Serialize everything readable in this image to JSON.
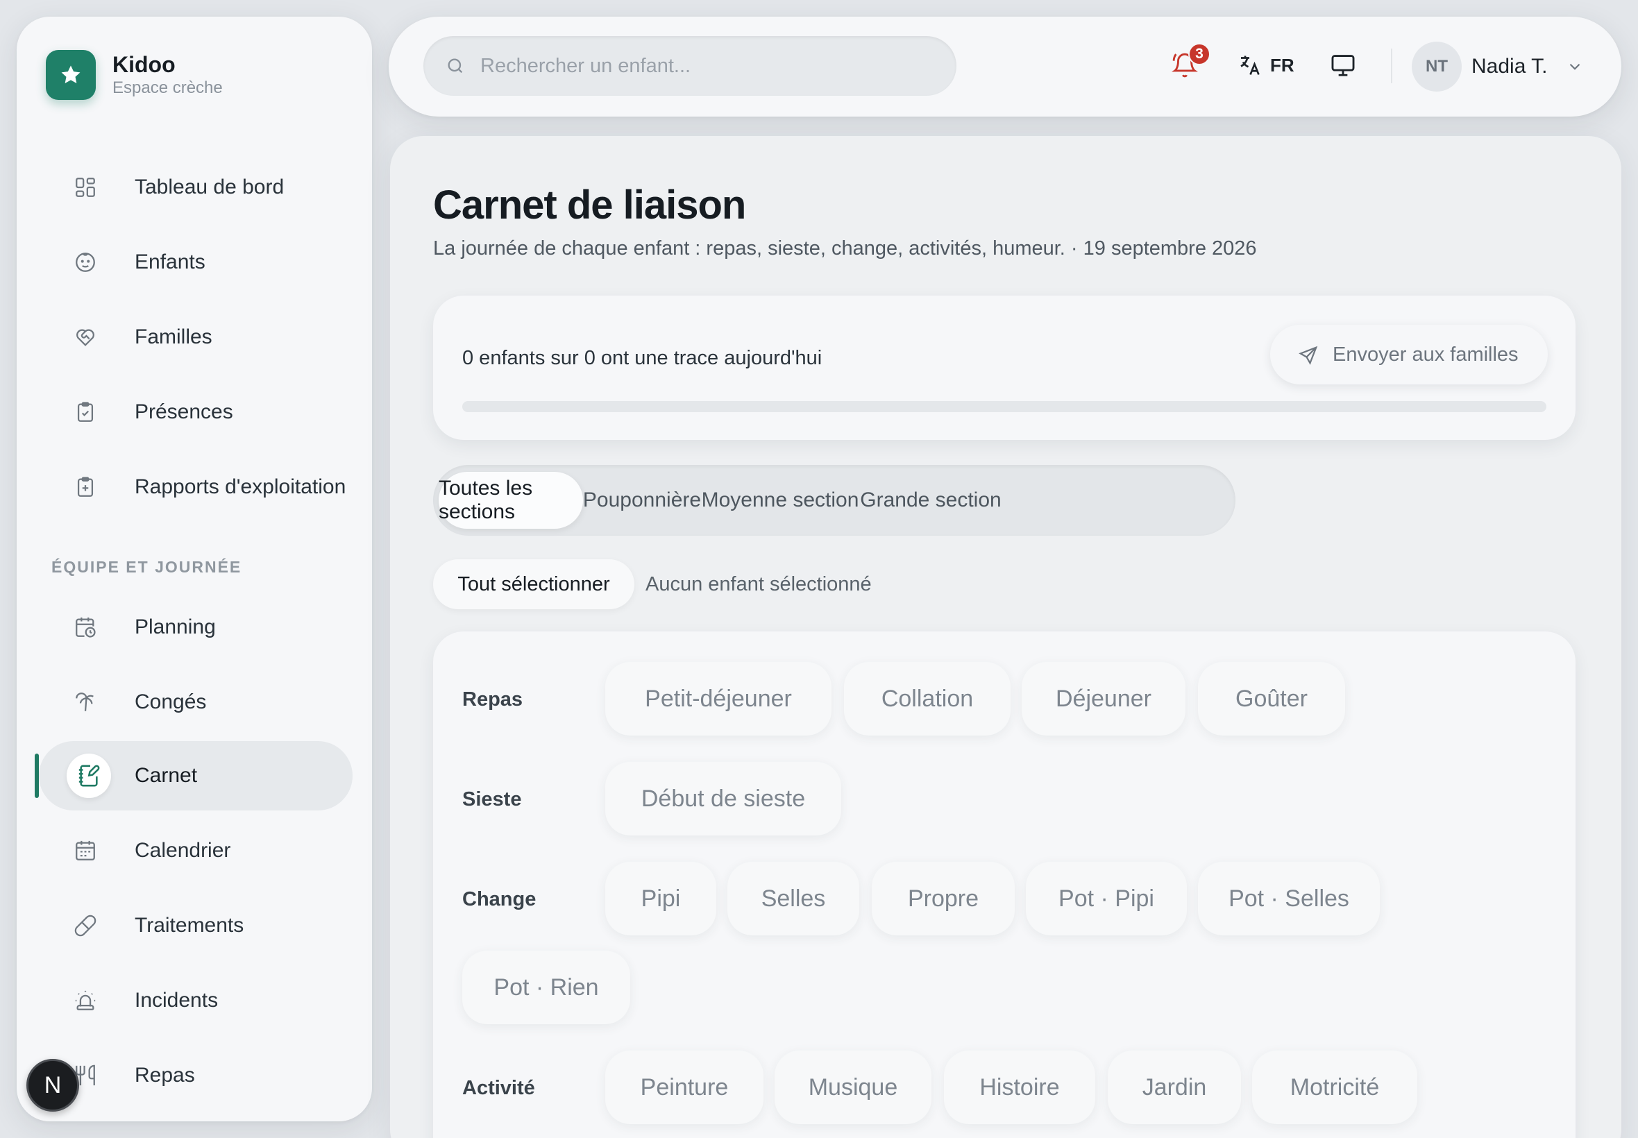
{
  "brand": {
    "name": "Kidoo",
    "subtitle": "Espace crèche"
  },
  "sidebar": {
    "items": [
      {
        "label": "Tableau de bord",
        "icon": "dashboard-icon"
      },
      {
        "label": "Enfants",
        "icon": "baby-face-icon"
      },
      {
        "label": "Familles",
        "icon": "heart-handshake-icon"
      },
      {
        "label": "Présences",
        "icon": "clipboard-check-icon"
      },
      {
        "label": "Rapports d'exploitation",
        "icon": "clipboard-plus-icon"
      }
    ],
    "section_title": "ÉQUIPE ET JOURNÉE",
    "team_items": [
      {
        "label": "Planning",
        "icon": "calendar-clock-icon"
      },
      {
        "label": "Congés",
        "icon": "palm-tree-icon"
      },
      {
        "label": "Carnet",
        "icon": "notebook-pen-icon",
        "active": true
      },
      {
        "label": "Calendrier",
        "icon": "calendar-icon"
      },
      {
        "label": "Traitements",
        "icon": "pill-icon"
      },
      {
        "label": "Incidents",
        "icon": "siren-icon"
      },
      {
        "label": "Repas",
        "icon": "utensils-icon"
      }
    ],
    "dev_badge": "N"
  },
  "topbar": {
    "search_placeholder": "Rechercher un enfant...",
    "notifications_count": "3",
    "language": "FR",
    "user_initials": "NT",
    "user_name": "Nadia T."
  },
  "page": {
    "title": "Carnet de liaison",
    "subtitle": "La journée de chaque enfant : repas, sieste, change, activités, humeur. · 19 septembre 2026"
  },
  "progress": {
    "text": "0 enfants sur 0 ont une trace aujourd'hui",
    "send_label": "Envoyer aux familles",
    "fraction": 0
  },
  "tabs": [
    "Toutes les sections",
    "Pouponnière",
    "Moyenne section",
    "Grande section"
  ],
  "selection": {
    "select_all": "Tout sélectionner",
    "status": "Aucun enfant sélectionné"
  },
  "actions": {
    "repas": {
      "label": "Repas",
      "chips": [
        "Petit-déjeuner",
        "Collation",
        "Déjeuner",
        "Goûter"
      ]
    },
    "sieste": {
      "label": "Sieste",
      "chips": [
        "Début de sieste"
      ]
    },
    "change": {
      "label": "Change",
      "chips": [
        "Pipi",
        "Selles",
        "Propre",
        "Pot · Pipi",
        "Pot · Selles",
        "Pot · Rien"
      ]
    },
    "activite": {
      "label": "Activité",
      "chips": [
        "Peinture",
        "Musique",
        "Histoire",
        "Jardin",
        "Motricité"
      ]
    }
  },
  "colors": {
    "accent": "#1f8068",
    "notification": "#c7362b"
  }
}
